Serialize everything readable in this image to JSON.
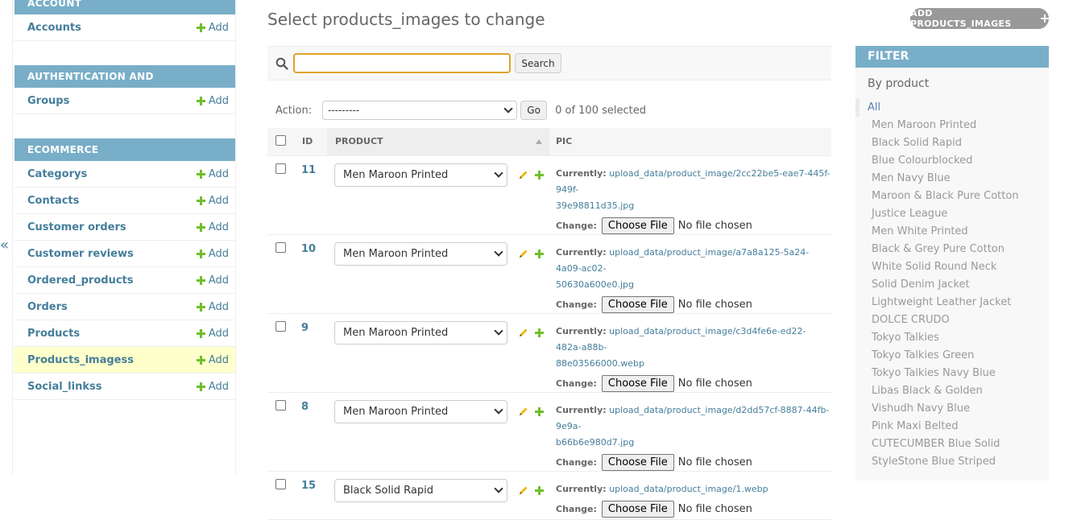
{
  "sidebar": {
    "collapse_label": "«",
    "add_label": "Add",
    "modules": [
      {
        "caption": "ACCOUNT",
        "models": [
          {
            "name": "Accounts"
          }
        ]
      },
      {
        "caption": "AUTHENTICATION AND AUTHORIZATION",
        "models": [
          {
            "name": "Groups"
          }
        ]
      },
      {
        "caption": "ECOMMERCE",
        "models": [
          {
            "name": "Categorys"
          },
          {
            "name": "Contacts"
          },
          {
            "name": "Customer orders"
          },
          {
            "name": "Customer reviews"
          },
          {
            "name": "Ordered_products"
          },
          {
            "name": "Orders"
          },
          {
            "name": "Products"
          },
          {
            "name": "Products_imagess",
            "current": true
          },
          {
            "name": "Social_linkss"
          }
        ]
      }
    ]
  },
  "main": {
    "title": "Select products_images to change",
    "add_button": "ADD PRODUCTS_IMAGES",
    "search": {
      "value": "",
      "button": "Search"
    },
    "actions": {
      "label": "Action:",
      "selected_option": "---------",
      "go": "Go",
      "counter": "0 of 100 selected"
    },
    "table": {
      "headers": {
        "id": "ID",
        "product": "PRODUCT",
        "pic": "PIC"
      },
      "currently_label": "Currently:",
      "change_label": "Change:",
      "file_button": "Choose File",
      "no_file": "No file chosen",
      "rows": [
        {
          "id": "11",
          "product": "Men Maroon Printed",
          "pic_line1": "upload_data/product_image/2cc22be5-eae7-445f-949f-",
          "pic_line2": "39e98811d35.jpg"
        },
        {
          "id": "10",
          "product": "Men Maroon Printed",
          "pic_line1": "upload_data/product_image/a7a8a125-5a24-4a09-ac02-",
          "pic_line2": "50630a600e0.jpg"
        },
        {
          "id": "9",
          "product": "Men Maroon Printed",
          "pic_line1": "upload_data/product_image/c3d4fe6e-ed22-482a-a88b-",
          "pic_line2": "88e03566000.webp"
        },
        {
          "id": "8",
          "product": "Men Maroon Printed",
          "pic_line1": "upload_data/product_image/d2dd57cf-8887-44fb-9e9a-",
          "pic_line2": "b66b6e980d7.jpg"
        },
        {
          "id": "15",
          "product": "Black Solid Rapid",
          "pic_line1": "upload_data/product_image/1.webp",
          "pic_line2": ""
        }
      ]
    }
  },
  "filter": {
    "title": "FILTER",
    "by": "By product",
    "options": [
      "All",
      "Men Maroon Printed",
      "Black Solid Rapid",
      "Blue Colourblocked",
      "Men Navy Blue",
      "Maroon & Black Pure Cotton",
      "Justice League",
      "Men White Printed",
      "Black & Grey Pure Cotton",
      "White Solid Round Neck",
      "Solid Denim Jacket",
      "Lightweight Leather Jacket",
      "DOLCE CRUDO",
      "Tokyo Talkies",
      "Tokyo Talkies Green",
      "Tokyo Talkies Navy Blue",
      "Libas Black & Golden",
      "Vishudh Navy Blue",
      "Pink Maxi Belted",
      "CUTECUMBER Blue Solid",
      "StyleStone Blue Striped"
    ]
  },
  "colors": {
    "header_blue": "#79aec8",
    "link": "#447e9b",
    "add_green": "#70bf2b",
    "current_row": "#ffffcc",
    "search_focus": "#e2a22d"
  }
}
